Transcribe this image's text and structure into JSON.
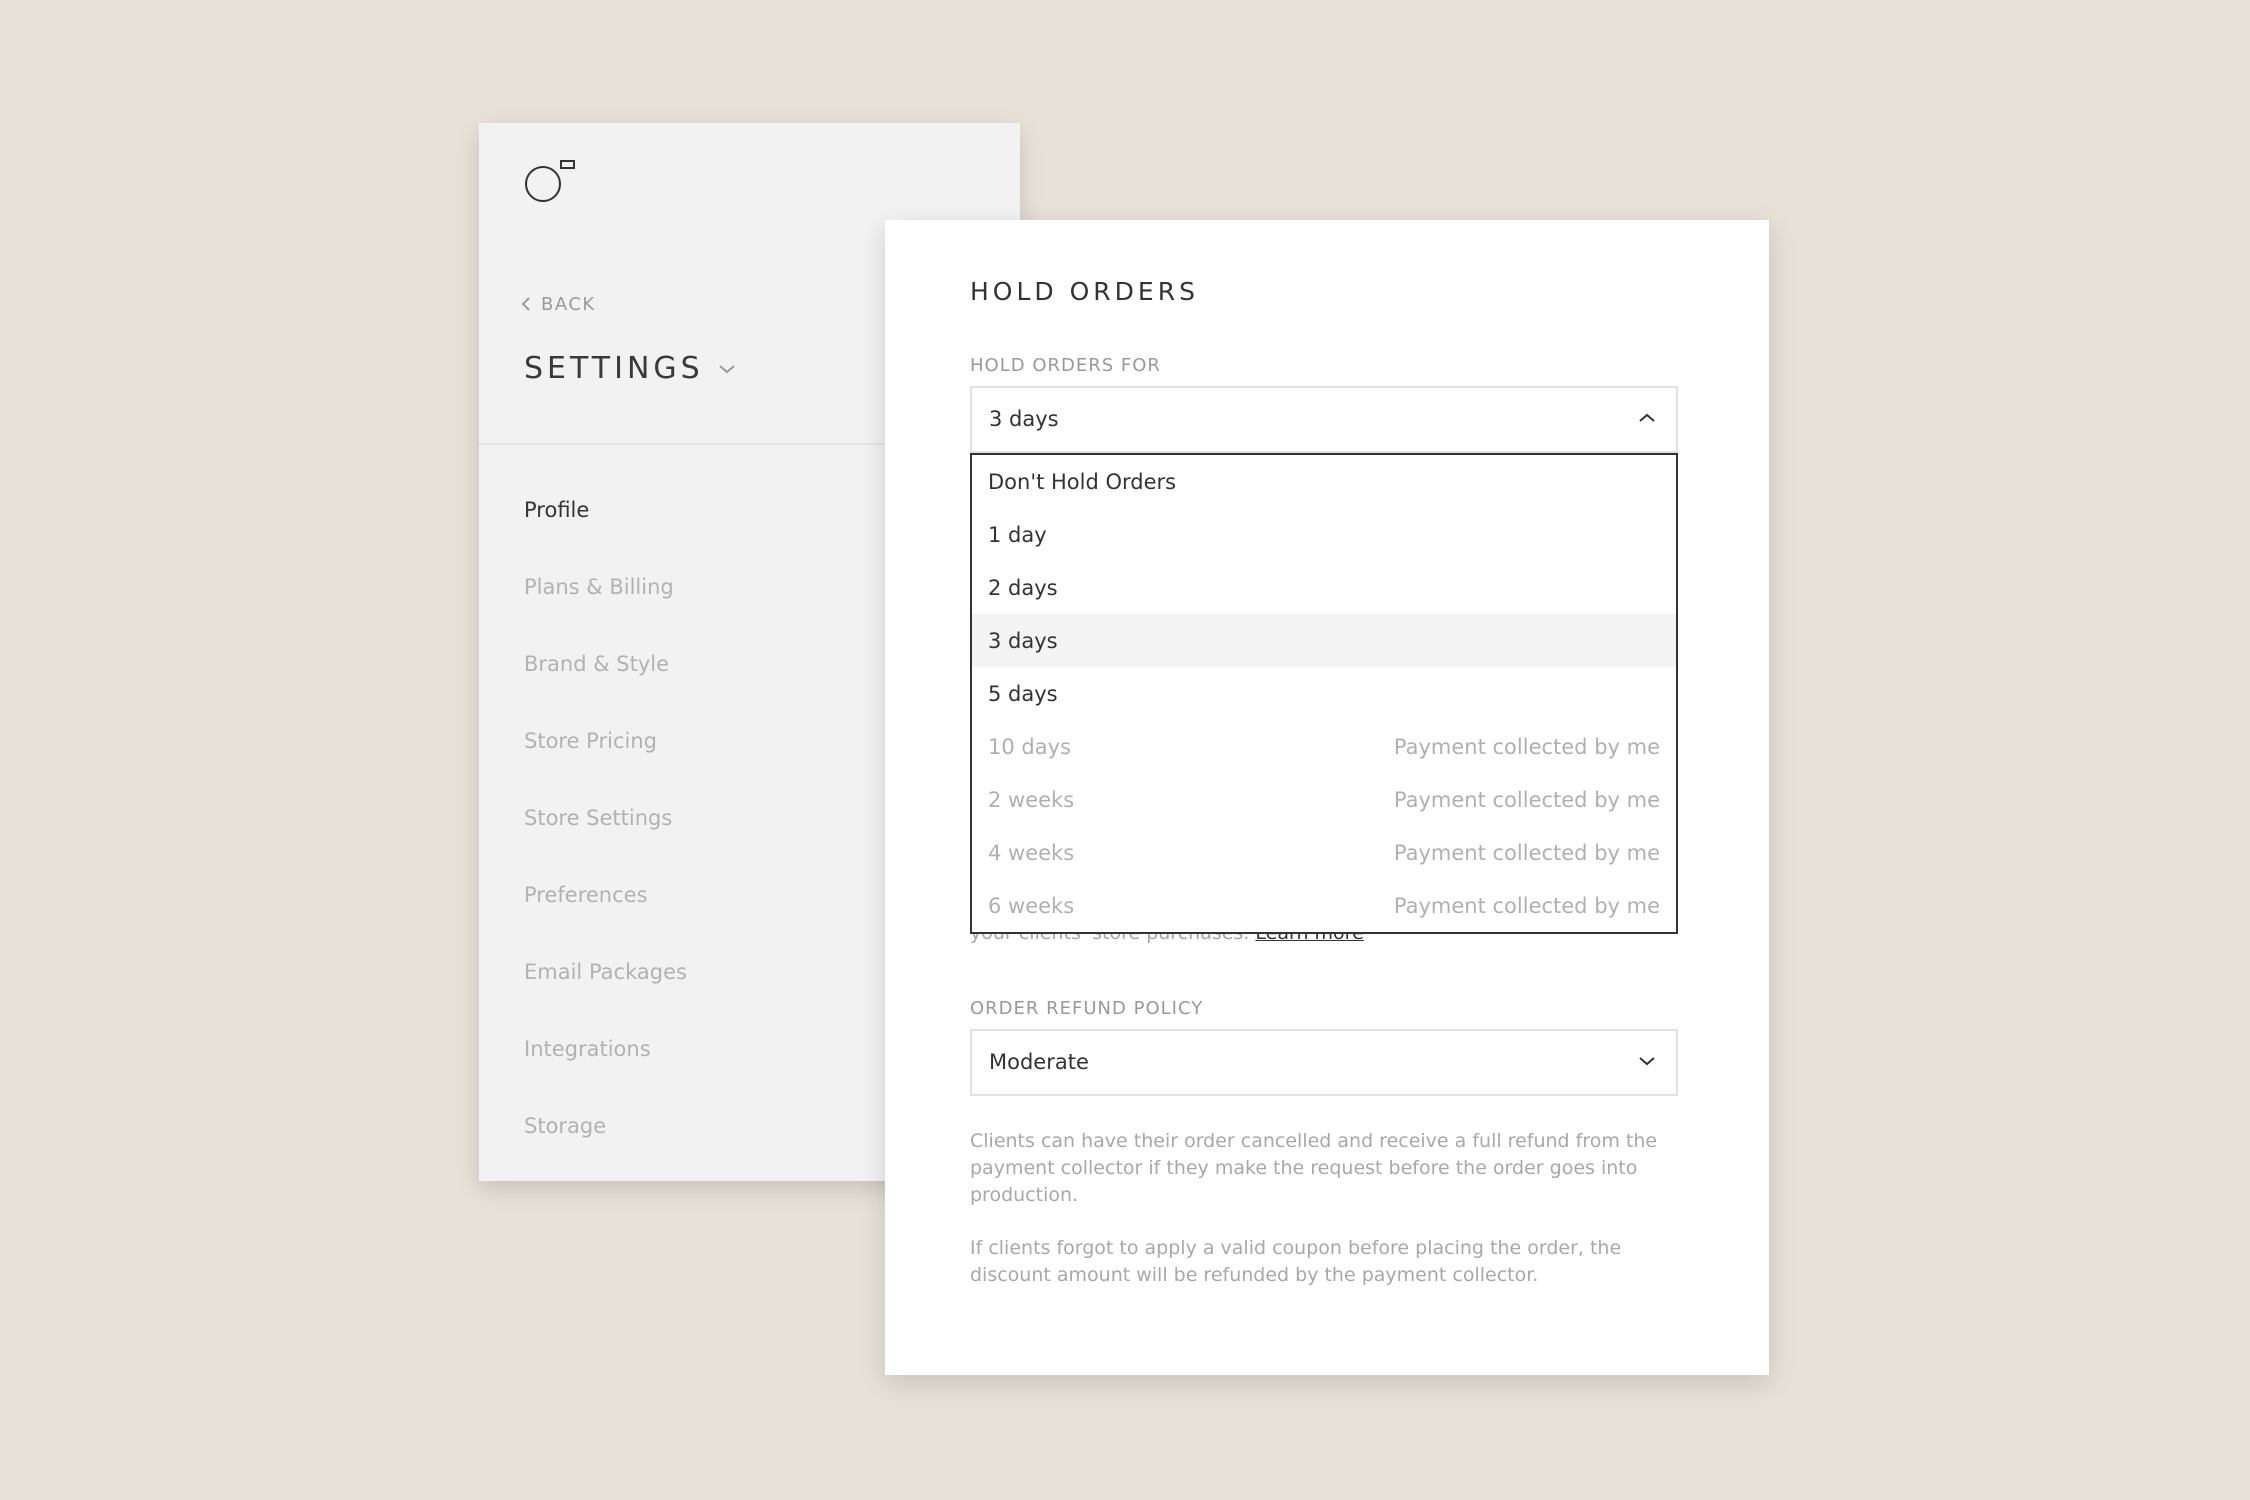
{
  "sidebar": {
    "back_label": "BACK",
    "title": "SETTINGS",
    "items": [
      {
        "label": "Profile"
      },
      {
        "label": "Plans & Billing"
      },
      {
        "label": "Brand & Style"
      },
      {
        "label": "Store Pricing"
      },
      {
        "label": "Store Settings"
      },
      {
        "label": "Preferences"
      },
      {
        "label": "Email Packages"
      },
      {
        "label": "Integrations"
      },
      {
        "label": "Storage"
      }
    ],
    "active_item": "Profile"
  },
  "panel": {
    "title": "HOLD ORDERS",
    "hold_orders": {
      "label": "HOLD ORDERS FOR",
      "value": "3 days",
      "options": [
        {
          "label": "Don't Hold Orders",
          "note": "",
          "enabled": true
        },
        {
          "label": "1 day",
          "note": "",
          "enabled": true
        },
        {
          "label": "2 days",
          "note": "",
          "enabled": true
        },
        {
          "label": "3 days",
          "note": "",
          "enabled": true,
          "selected": true
        },
        {
          "label": "5 days",
          "note": "",
          "enabled": true
        },
        {
          "label": "10 days",
          "note": "Payment collected by me",
          "enabled": false
        },
        {
          "label": "2 weeks",
          "note": "Payment collected by me",
          "enabled": false
        },
        {
          "label": "4 weeks",
          "note": "Payment collected by me",
          "enabled": false
        },
        {
          "label": "6 weeks",
          "note": "Payment collected by me",
          "enabled": false
        }
      ],
      "help_text": "your clients' store purchases.",
      "learn_more": "Learn more"
    },
    "refund_policy": {
      "label": "ORDER REFUND POLICY",
      "value": "Moderate",
      "description_1": "Clients can have their order cancelled and receive a full refund from the payment collector if they make the request before the order goes into production.",
      "description_2": "If clients forgot to apply a valid coupon before placing the order, the discount amount will be refunded by the payment collector."
    }
  },
  "colors": {
    "background": "#e8e1d8",
    "sidebar_bg": "#f2f2f2",
    "panel_bg": "#ffffff",
    "text_dark": "#333333",
    "text_muted": "#b0b0b0"
  }
}
